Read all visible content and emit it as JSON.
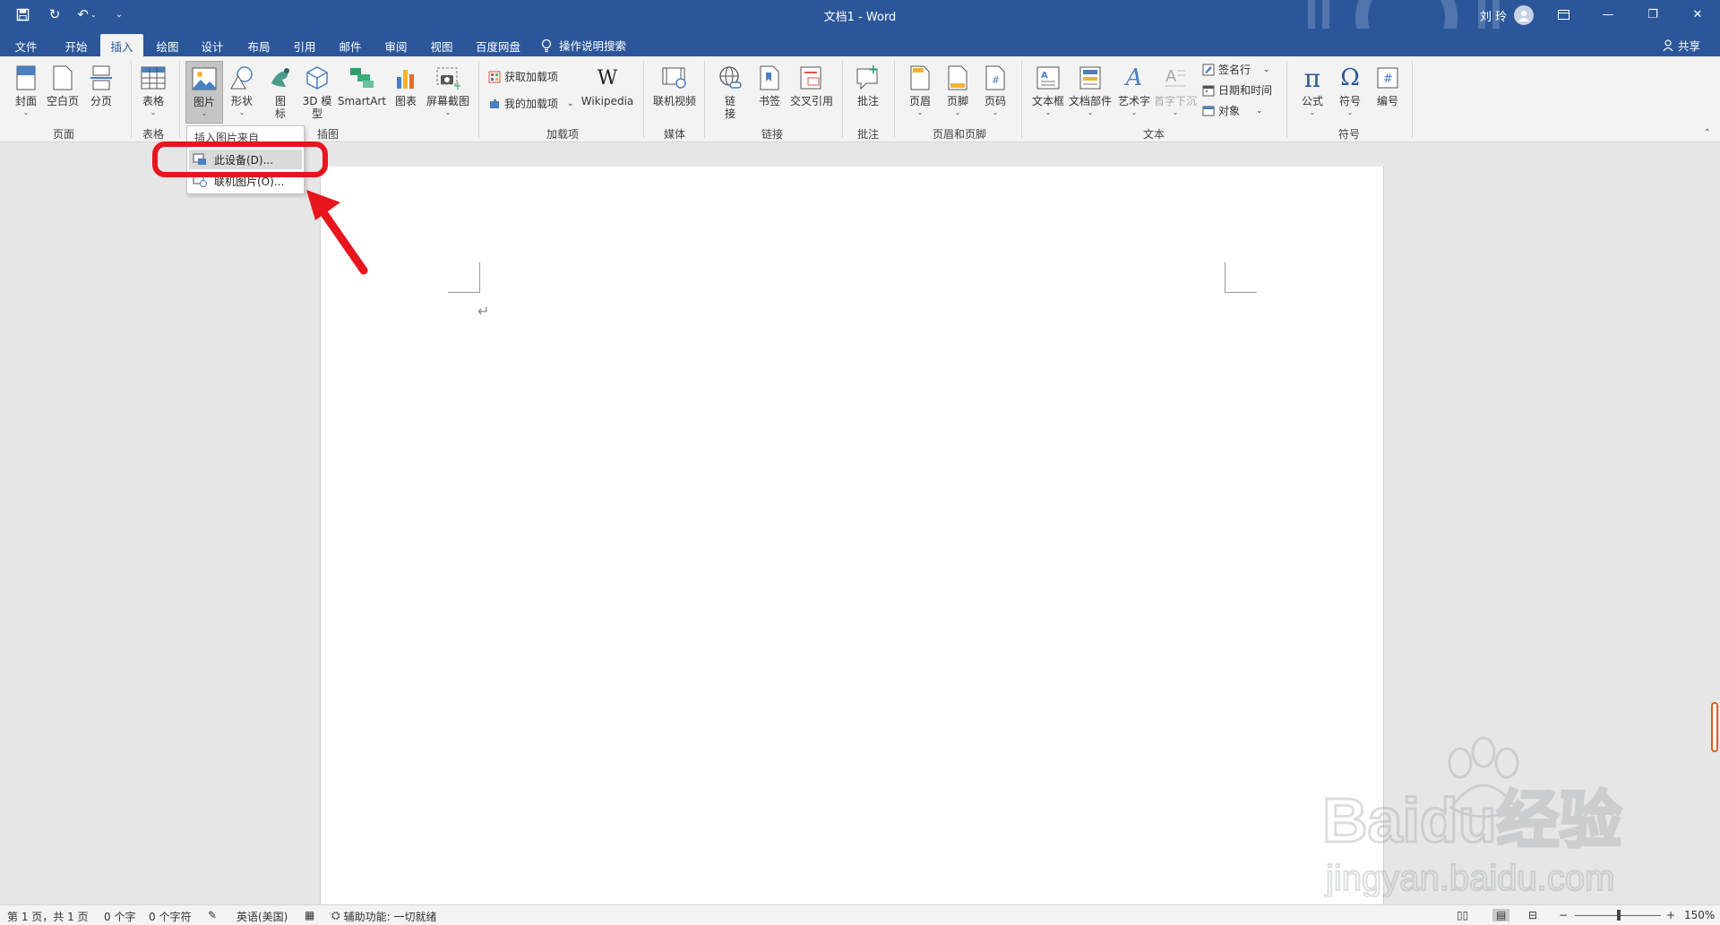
{
  "titlebar": {
    "doc_title": "文档1 - Word",
    "user_name": "刘 玲",
    "qat_icons": [
      "save-icon",
      "autosave-icon",
      "undo-icon",
      "customize-icon"
    ]
  },
  "tabs": [
    "文件",
    "开始",
    "插入",
    "绘图",
    "设计",
    "布局",
    "引用",
    "邮件",
    "审阅",
    "视图",
    "百度网盘"
  ],
  "active_tab": "插入",
  "tell_me": "操作说明搜索",
  "share": "共享",
  "ribbon": {
    "pages": {
      "cover": "封面",
      "blank": "空白页",
      "break": "分页",
      "group": "页面"
    },
    "tables": {
      "table": "表格",
      "group": "表格"
    },
    "illustrations": {
      "pictures": "图片",
      "shapes": "形状",
      "icons": "图标",
      "model3d": "3D 模型",
      "smartart": "SmartArt",
      "chart": "图表",
      "screenshot": "屏幕截图",
      "group": "插图"
    },
    "addins": {
      "get": "获取加载项",
      "mine": "我的加载项",
      "wikipedia": "Wikipedia",
      "group": "加载项"
    },
    "media": {
      "video": "联机视频",
      "group": "媒体"
    },
    "links": {
      "link": "链接",
      "bookmark": "书签",
      "crossref": "交叉引用",
      "group": "链接"
    },
    "comments": {
      "comment": "批注",
      "group": "批注"
    },
    "header_footer": {
      "header": "页眉",
      "footer": "页脚",
      "page_number": "页码",
      "group": "页眉和页脚"
    },
    "text": {
      "textbox": "文本框",
      "quickparts": "文档部件",
      "wordart": "艺术字",
      "dropcap": "首字下沉",
      "signature": "签名行",
      "datetime": "日期和时间",
      "object": "对象",
      "group": "文本"
    },
    "symbols": {
      "equation": "公式",
      "symbol": "符号",
      "number": "编号",
      "group": "符号"
    }
  },
  "picture_menu": {
    "header": "插入图片来自",
    "items": [
      "此设备(D)...",
      "联机图片(O)..."
    ]
  },
  "status": {
    "page": "第 1 页，共 1 页",
    "words": "0 个字",
    "chars": "0 个字符",
    "language": "英语(美国)",
    "accessibility": "辅助功能: 一切就绪",
    "zoom": "150%"
  },
  "watermark": {
    "brand": "Baidu经验",
    "url": "jingyan.baidu.com"
  },
  "colors": {
    "title_blue": "#2b579a",
    "highlight_red": "#e8141e"
  }
}
